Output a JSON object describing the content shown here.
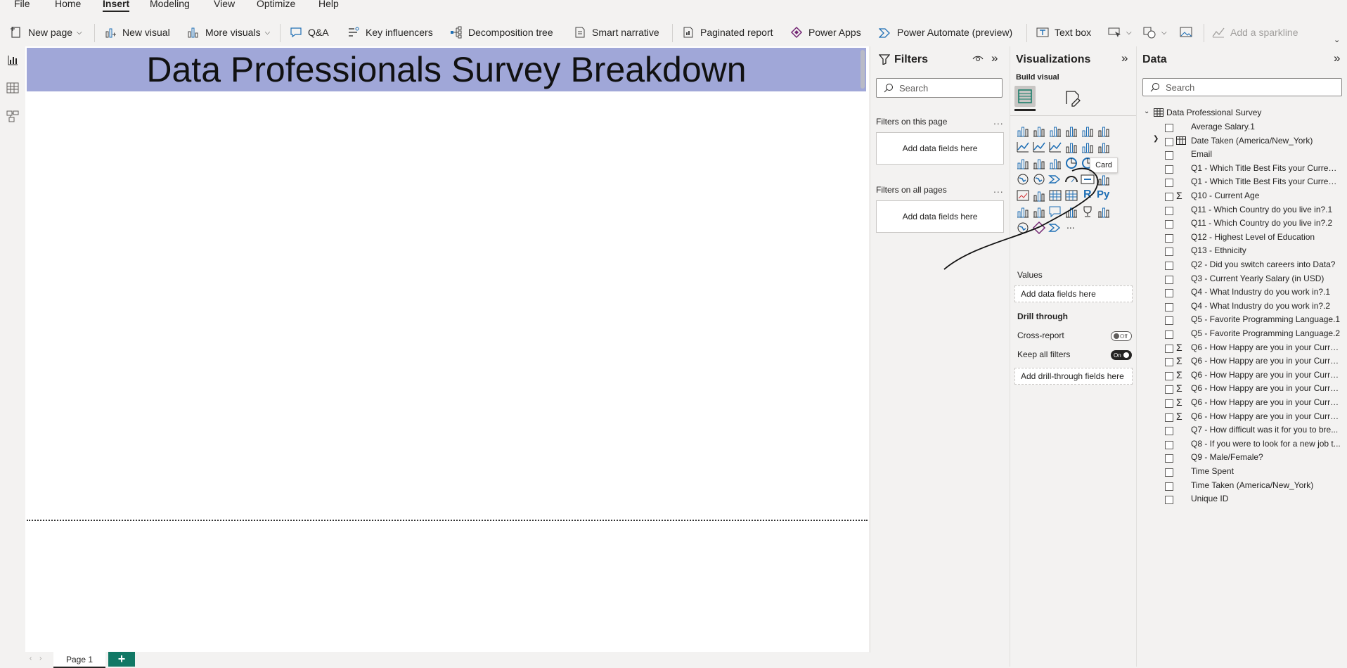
{
  "menu": [
    "File",
    "Home",
    "Insert",
    "Modeling",
    "View",
    "Optimize",
    "Help"
  ],
  "menu_active": "Insert",
  "ribbon": {
    "new_page": "New page",
    "new_visual": "New visual",
    "more_visuals": "More visuals",
    "qa": "Q&A",
    "key_influencers": "Key influencers",
    "decomposition_tree": "Decomposition tree",
    "smart_narrative": "Smart narrative",
    "paginated_report": "Paginated report",
    "power_apps": "Power Apps",
    "power_automate": "Power Automate (preview)",
    "text_box": "Text box",
    "add_sparkline": "Add a sparkline"
  },
  "canvas": {
    "title": "Data Professionals Survey Breakdown",
    "title_bg": "#a0a7d8"
  },
  "pages": {
    "tab": "Page 1",
    "add": "+"
  },
  "filters": {
    "title": "Filters",
    "search_placeholder": "Search",
    "on_this_page": "Filters on this page",
    "on_all_pages": "Filters on all pages",
    "add_fields": "Add data fields here",
    "more": "..."
  },
  "visualizations": {
    "title": "Visualizations",
    "build_visual": "Build visual",
    "tooltip": "Card",
    "values_label": "Values",
    "values_drop": "Add data fields here",
    "drill_through": "Drill through",
    "cross_report": "Cross-report",
    "cross_report_state": "Off",
    "keep_all_filters": "Keep all filters",
    "keep_all_filters_state": "On",
    "drill_drop": "Add drill-through fields here",
    "r_label": "R",
    "py_label": "Py",
    "more_visuals": "..."
  },
  "data": {
    "title": "Data",
    "search_placeholder": "Search",
    "table": "Data Professional Survey",
    "fields": [
      {
        "label": "Average Salary.1",
        "sigma": false
      },
      {
        "label": "Date Taken (America/New_York)",
        "sigma": false,
        "table_icon": true
      },
      {
        "label": "Email",
        "sigma": false
      },
      {
        "label": "Q1 - Which Title Best Fits your Current ...",
        "sigma": false
      },
      {
        "label": "Q1 - Which Title Best Fits your Current ...",
        "sigma": false
      },
      {
        "label": "Q10 - Current Age",
        "sigma": true
      },
      {
        "label": "Q11 - Which Country do you live in?.1",
        "sigma": false
      },
      {
        "label": "Q11 - Which Country do you live in?.2",
        "sigma": false
      },
      {
        "label": "Q12 - Highest Level of Education",
        "sigma": false
      },
      {
        "label": "Q13 - Ethnicity",
        "sigma": false
      },
      {
        "label": "Q2 - Did you switch careers into Data?",
        "sigma": false
      },
      {
        "label": "Q3 - Current Yearly Salary (in USD)",
        "sigma": false
      },
      {
        "label": "Q4 - What Industry do you work in?.1",
        "sigma": false
      },
      {
        "label": "Q4 - What Industry do you work in?.2",
        "sigma": false
      },
      {
        "label": "Q5 - Favorite Programming Language.1",
        "sigma": false
      },
      {
        "label": "Q5 - Favorite Programming Language.2",
        "sigma": false
      },
      {
        "label": "Q6 - How Happy are you in your Curre...",
        "sigma": true
      },
      {
        "label": "Q6 - How Happy are you in your Curre...",
        "sigma": true
      },
      {
        "label": "Q6 - How Happy are you in your Curre...",
        "sigma": true
      },
      {
        "label": "Q6 - How Happy are you in your Curre...",
        "sigma": true
      },
      {
        "label": "Q6 - How Happy are you in your Curre...",
        "sigma": true
      },
      {
        "label": "Q6 - How Happy are you in your Curre...",
        "sigma": true
      },
      {
        "label": "Q7 - How difficult was it for you to bre...",
        "sigma": false
      },
      {
        "label": "Q8 - If you were to look for a new job t...",
        "sigma": false
      },
      {
        "label": "Q9 - Male/Female?",
        "sigma": false
      },
      {
        "label": "Time Spent",
        "sigma": false
      },
      {
        "label": "Time Taken (America/New_York)",
        "sigma": false
      },
      {
        "label": "Unique ID",
        "sigma": false
      }
    ]
  },
  "colors": {
    "accent": "#117865",
    "ribbon_icon": "#1f6fb5",
    "power_apps": "#742774"
  }
}
